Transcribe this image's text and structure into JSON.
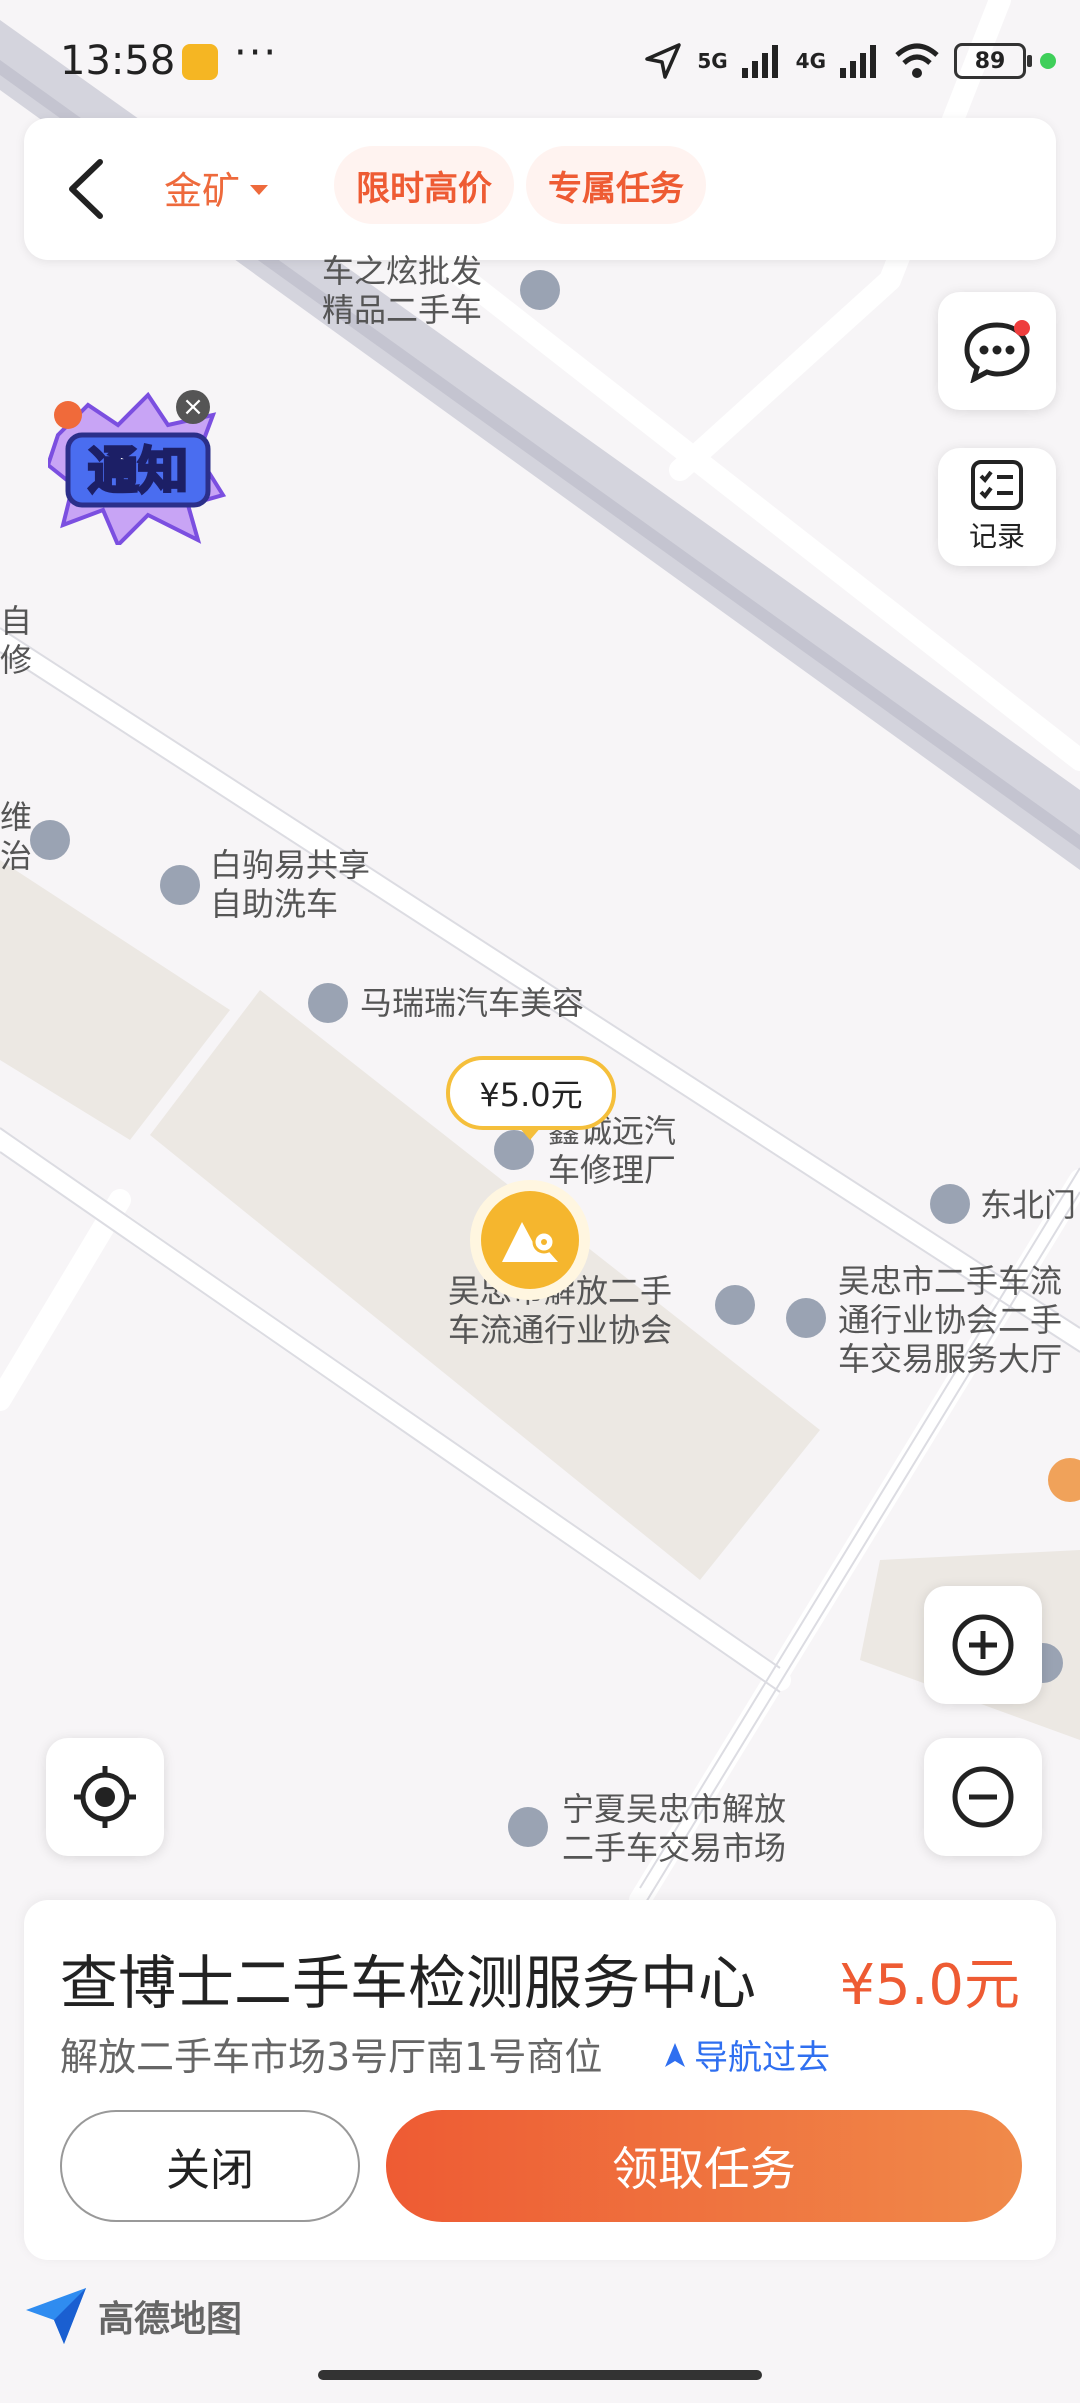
{
  "status_bar": {
    "time": "13:58",
    "dots": "···",
    "signal_5g": "5G",
    "signal_4g": "4G",
    "battery": "89"
  },
  "header": {
    "tab_gold": "金矿",
    "tab_high_price": "限时高价",
    "tab_exclusive": "专属任务"
  },
  "right_tools": {
    "record_label": "记录"
  },
  "notice": {
    "text": "通知"
  },
  "map_labels": {
    "poi_top": "车之炫批发\n精品二手车",
    "poi_left_edge_1": "自\n修",
    "poi_left_edge_2": "维\n治",
    "poi_wash": "白驹易共享\n自助洗车",
    "poi_beauty": "马瑞瑞汽车美容",
    "poi_repair": "鑫诚远汽\n车修理厂",
    "poi_northeast": "东北门",
    "poi_assoc": "吴忠市解放二手\n车流通行业协会",
    "poi_hall": "吴忠市二手车流\n通行业协会二手\n车交易服务大厅",
    "poi_market": "宁夏吴忠市解放\n二手车交易市场"
  },
  "marker": {
    "price": "¥5.0元"
  },
  "card": {
    "title": "查博士二手车检测服务中心",
    "price": "¥5.0元",
    "address": "解放二手车市场3号厅南1号商位",
    "navigate": "导航过去",
    "close_label": "关闭",
    "take_label": "领取任务"
  },
  "brand": {
    "map_provider": "高德地图"
  },
  "colors": {
    "accent": "#ee5b33",
    "marker": "#f5b62e",
    "nav_blue": "#2f6ff0"
  }
}
